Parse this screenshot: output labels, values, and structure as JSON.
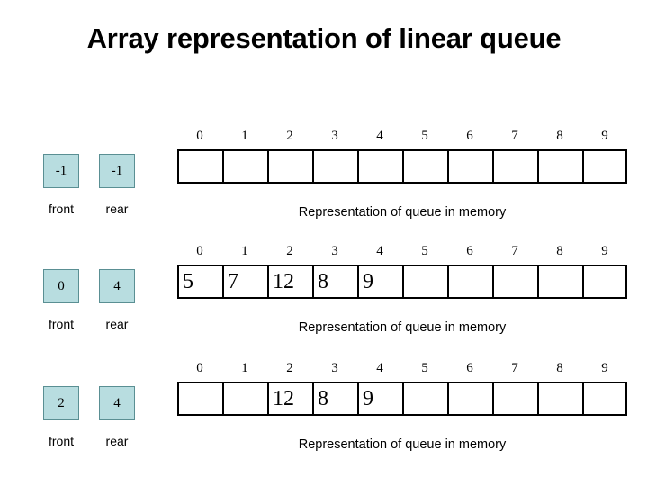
{
  "title": "Array representation of linear queue",
  "colors": {
    "pointer_box_fill": "#b8dde0",
    "pointer_box_border": "#5a8f93",
    "array_border": "#000000",
    "background": "#ffffff",
    "text": "#000000"
  },
  "labels": {
    "front": "front",
    "rear": "rear",
    "caption": "Representation of queue in memory"
  },
  "indices": [
    "0",
    "1",
    "2",
    "3",
    "4",
    "5",
    "6",
    "7",
    "8",
    "9"
  ],
  "rows": [
    {
      "front": "-1",
      "rear": "-1",
      "front_label": "front",
      "rear_label": "rear",
      "caption": "Representation of queue in memory",
      "cells": [
        "",
        "",
        "",
        "",
        "",
        "",
        "",
        "",
        "",
        ""
      ]
    },
    {
      "front": "0",
      "rear": "4",
      "front_label": "front",
      "rear_label": "rear",
      "caption": "Representation of queue in memory",
      "cells": [
        "5",
        "7",
        "12",
        "8",
        "9",
        "",
        "",
        "",
        "",
        ""
      ]
    },
    {
      "front": "2",
      "rear": "4",
      "front_label": "front",
      "rear_label": "rear",
      "caption": "Representation of queue in memory",
      "cells": [
        "",
        "",
        "12",
        "8",
        "9",
        "",
        "",
        "",
        "",
        ""
      ]
    }
  ]
}
